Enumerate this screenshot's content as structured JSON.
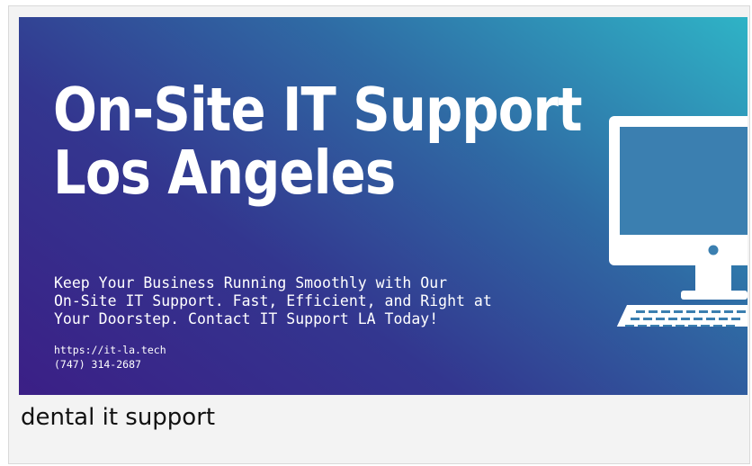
{
  "banner": {
    "headline_line1": "On-Site IT Support",
    "headline_line2": "Los Angeles",
    "tagline_line1": "Keep Your Business Running Smoothly with Our",
    "tagline_line2": "On-Site IT Support. Fast, Efficient, and Right at",
    "tagline_line3": "Your Doorstep. Contact IT Support LA Today!",
    "url": "https://it-la.tech",
    "phone": "(747) 314-2687",
    "icon": "desktop-computer-icon",
    "gradient_colors": [
      "#3b1f86",
      "#33368f",
      "#2f6aa4",
      "#2fb3c6"
    ]
  },
  "caption": "dental it support"
}
